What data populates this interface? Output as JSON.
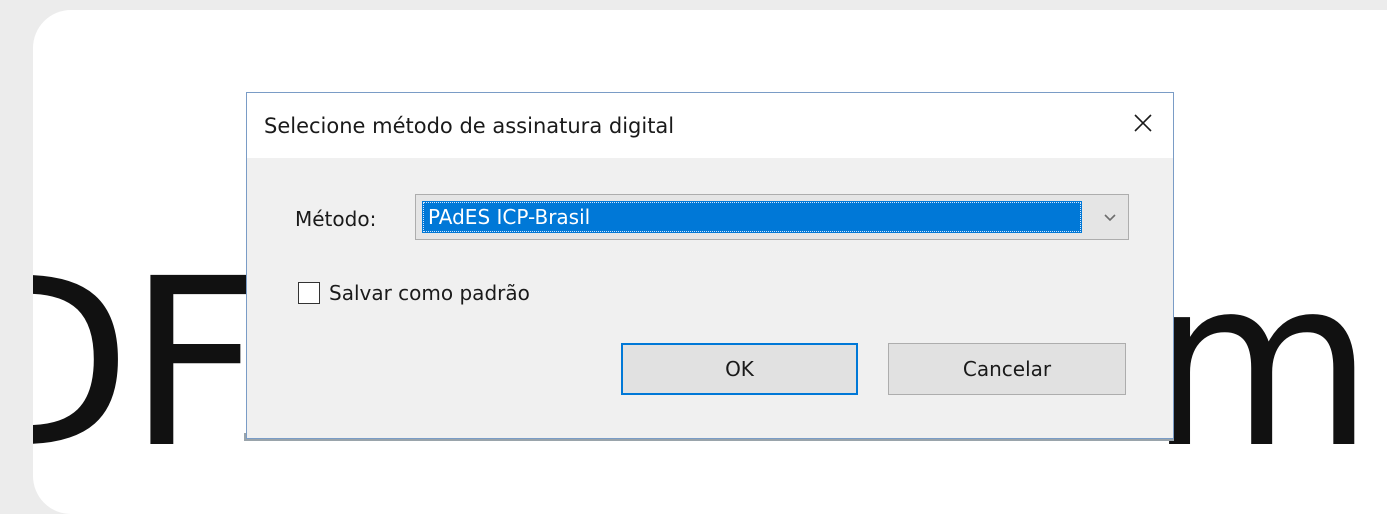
{
  "dialog": {
    "title": "Selecione método de assinatura digital",
    "close_icon": "close-x-icon",
    "method_label": "Método:",
    "method_value": "PAdES ICP-Brasil",
    "dropdown_icon": "chevron-down-icon",
    "save_default_label": "Salvar como padrão",
    "save_default_checked": false,
    "ok_label": "OK",
    "cancel_label": "Cancelar"
  },
  "background": {
    "left_text": "DF",
    "right_text": "mı"
  },
  "colors": {
    "selection": "#0078d7",
    "dialog_border": "#7a9cc6",
    "dialog_body": "#f0f0f0"
  }
}
